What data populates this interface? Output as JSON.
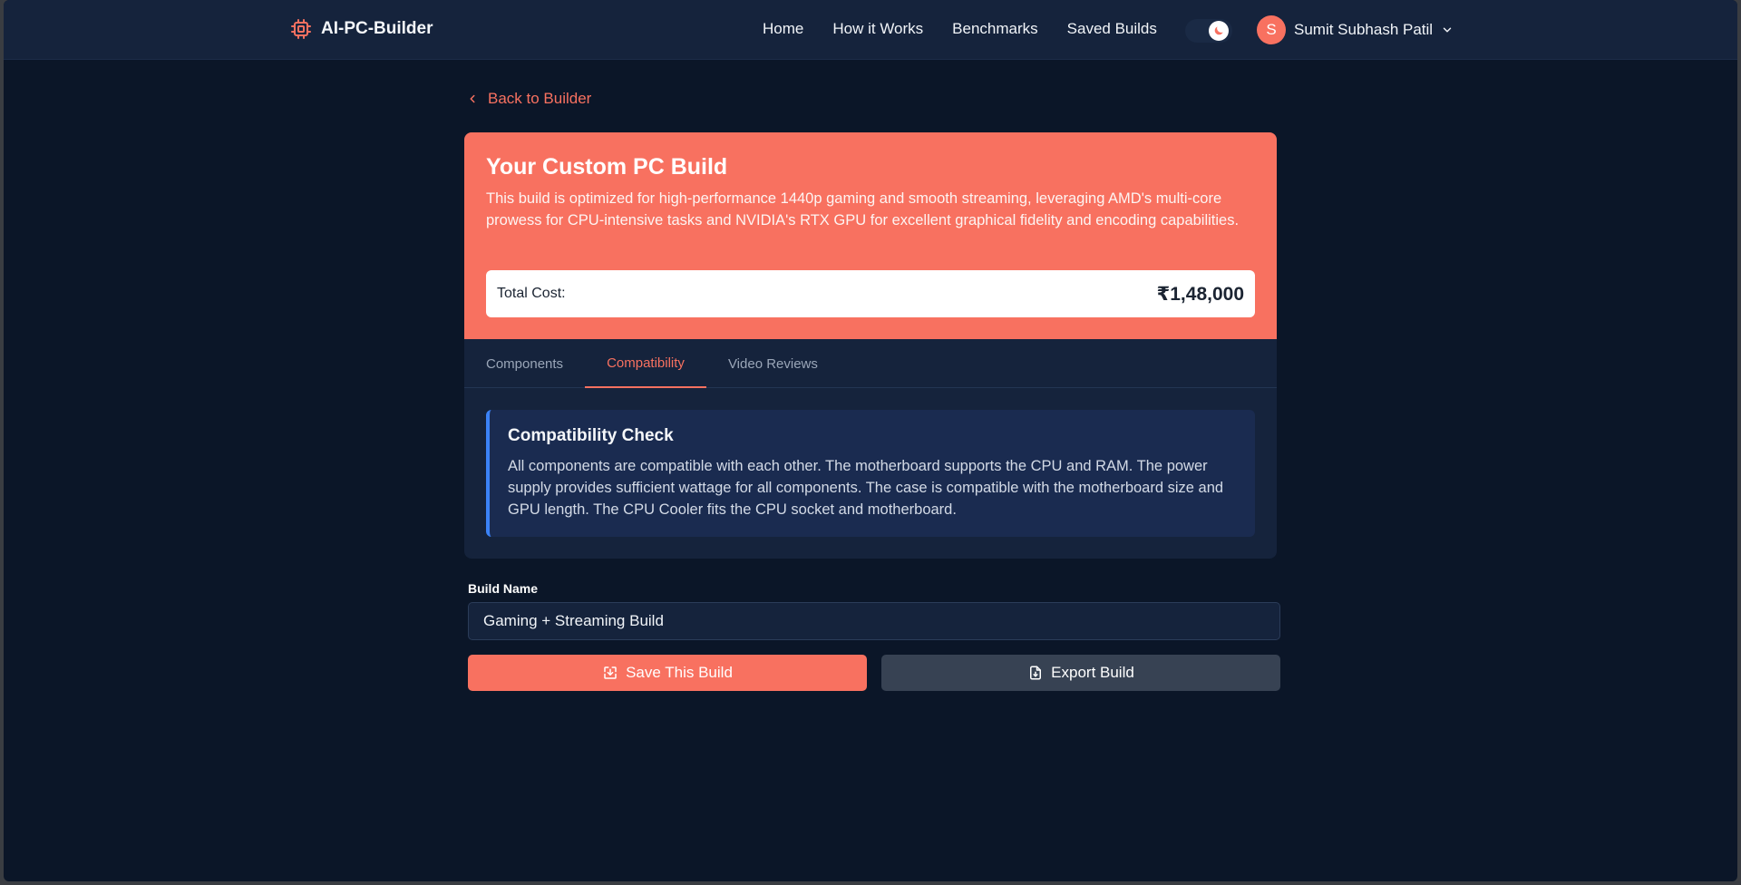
{
  "navbar": {
    "brand": "AI-PC-Builder",
    "links": [
      "Home",
      "How it Works",
      "Benchmarks",
      "Saved Builds"
    ],
    "user": {
      "initial": "S",
      "name": "Sumit Subhash Patil"
    }
  },
  "back_label": "Back to Builder",
  "build": {
    "title": "Your Custom PC Build",
    "description": "This build is optimized for high-performance 1440p gaming and smooth streaming, leveraging AMD's multi-core prowess for CPU-intensive tasks and NVIDIA's RTX GPU for excellent graphical fidelity and encoding capabilities.",
    "total_label": "Total Cost:",
    "total_value": "₹1,48,000"
  },
  "tabs": [
    {
      "label": "Components",
      "active": false
    },
    {
      "label": "Compatibility",
      "active": true
    },
    {
      "label": "Video Reviews",
      "active": false
    }
  ],
  "compatibility": {
    "title": "Compatibility Check",
    "text": "All components are compatible with each other. The motherboard supports the CPU and RAM. The power supply provides sufficient wattage for all components. The case is compatible with the motherboard size and GPU length. The CPU Cooler fits the CPU socket and motherboard."
  },
  "build_name": {
    "label": "Build Name",
    "value": "Gaming + Streaming Build"
  },
  "actions": {
    "save": "Save This Build",
    "export": "Export Build"
  },
  "colors": {
    "accent": "#f87160",
    "background": "#0b1628",
    "surface": "#15233c",
    "info_border": "#3b82f6"
  }
}
